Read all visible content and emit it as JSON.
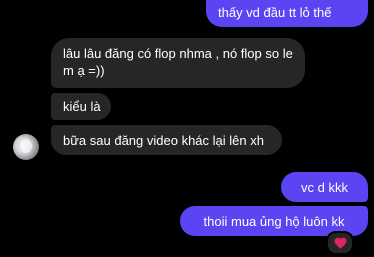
{
  "messages": [
    {
      "id": "m1",
      "direction": "sent",
      "text": "thấy vd đầu tt lỏ thế"
    },
    {
      "id": "m2",
      "direction": "received",
      "text": "lâu lâu đăng có flop nhma , nó flop so le m ạ =))"
    },
    {
      "id": "m3",
      "direction": "received",
      "text": "kiểu là"
    },
    {
      "id": "m4",
      "direction": "received",
      "text": "bữa sau đăng video khác lại lên xh"
    },
    {
      "id": "m5",
      "direction": "sent",
      "text": "vc d kkk"
    },
    {
      "id": "m6",
      "direction": "sent",
      "text": "thoii mua ủng hộ luôn kk"
    }
  ],
  "reaction": {
    "icon": "heart-icon",
    "color": "#e0245e"
  },
  "colors": {
    "sent_bubble": "#5b45f3",
    "received_bubble": "#262626",
    "background": "#000000"
  }
}
